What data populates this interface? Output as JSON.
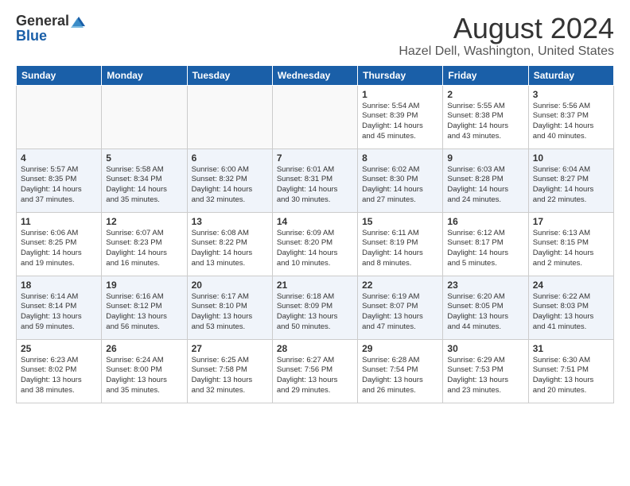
{
  "header": {
    "logo_general": "General",
    "logo_blue": "Blue",
    "month_title": "August 2024",
    "location": "Hazel Dell, Washington, United States"
  },
  "weekdays": [
    "Sunday",
    "Monday",
    "Tuesday",
    "Wednesday",
    "Thursday",
    "Friday",
    "Saturday"
  ],
  "weeks": [
    [
      {
        "day": "",
        "info": ""
      },
      {
        "day": "",
        "info": ""
      },
      {
        "day": "",
        "info": ""
      },
      {
        "day": "",
        "info": ""
      },
      {
        "day": "1",
        "info": "Sunrise: 5:54 AM\nSunset: 8:39 PM\nDaylight: 14 hours\nand 45 minutes."
      },
      {
        "day": "2",
        "info": "Sunrise: 5:55 AM\nSunset: 8:38 PM\nDaylight: 14 hours\nand 43 minutes."
      },
      {
        "day": "3",
        "info": "Sunrise: 5:56 AM\nSunset: 8:37 PM\nDaylight: 14 hours\nand 40 minutes."
      }
    ],
    [
      {
        "day": "4",
        "info": "Sunrise: 5:57 AM\nSunset: 8:35 PM\nDaylight: 14 hours\nand 37 minutes."
      },
      {
        "day": "5",
        "info": "Sunrise: 5:58 AM\nSunset: 8:34 PM\nDaylight: 14 hours\nand 35 minutes."
      },
      {
        "day": "6",
        "info": "Sunrise: 6:00 AM\nSunset: 8:32 PM\nDaylight: 14 hours\nand 32 minutes."
      },
      {
        "day": "7",
        "info": "Sunrise: 6:01 AM\nSunset: 8:31 PM\nDaylight: 14 hours\nand 30 minutes."
      },
      {
        "day": "8",
        "info": "Sunrise: 6:02 AM\nSunset: 8:30 PM\nDaylight: 14 hours\nand 27 minutes."
      },
      {
        "day": "9",
        "info": "Sunrise: 6:03 AM\nSunset: 8:28 PM\nDaylight: 14 hours\nand 24 minutes."
      },
      {
        "day": "10",
        "info": "Sunrise: 6:04 AM\nSunset: 8:27 PM\nDaylight: 14 hours\nand 22 minutes."
      }
    ],
    [
      {
        "day": "11",
        "info": "Sunrise: 6:06 AM\nSunset: 8:25 PM\nDaylight: 14 hours\nand 19 minutes."
      },
      {
        "day": "12",
        "info": "Sunrise: 6:07 AM\nSunset: 8:23 PM\nDaylight: 14 hours\nand 16 minutes."
      },
      {
        "day": "13",
        "info": "Sunrise: 6:08 AM\nSunset: 8:22 PM\nDaylight: 14 hours\nand 13 minutes."
      },
      {
        "day": "14",
        "info": "Sunrise: 6:09 AM\nSunset: 8:20 PM\nDaylight: 14 hours\nand 10 minutes."
      },
      {
        "day": "15",
        "info": "Sunrise: 6:11 AM\nSunset: 8:19 PM\nDaylight: 14 hours\nand 8 minutes."
      },
      {
        "day": "16",
        "info": "Sunrise: 6:12 AM\nSunset: 8:17 PM\nDaylight: 14 hours\nand 5 minutes."
      },
      {
        "day": "17",
        "info": "Sunrise: 6:13 AM\nSunset: 8:15 PM\nDaylight: 14 hours\nand 2 minutes."
      }
    ],
    [
      {
        "day": "18",
        "info": "Sunrise: 6:14 AM\nSunset: 8:14 PM\nDaylight: 13 hours\nand 59 minutes."
      },
      {
        "day": "19",
        "info": "Sunrise: 6:16 AM\nSunset: 8:12 PM\nDaylight: 13 hours\nand 56 minutes."
      },
      {
        "day": "20",
        "info": "Sunrise: 6:17 AM\nSunset: 8:10 PM\nDaylight: 13 hours\nand 53 minutes."
      },
      {
        "day": "21",
        "info": "Sunrise: 6:18 AM\nSunset: 8:09 PM\nDaylight: 13 hours\nand 50 minutes."
      },
      {
        "day": "22",
        "info": "Sunrise: 6:19 AM\nSunset: 8:07 PM\nDaylight: 13 hours\nand 47 minutes."
      },
      {
        "day": "23",
        "info": "Sunrise: 6:20 AM\nSunset: 8:05 PM\nDaylight: 13 hours\nand 44 minutes."
      },
      {
        "day": "24",
        "info": "Sunrise: 6:22 AM\nSunset: 8:03 PM\nDaylight: 13 hours\nand 41 minutes."
      }
    ],
    [
      {
        "day": "25",
        "info": "Sunrise: 6:23 AM\nSunset: 8:02 PM\nDaylight: 13 hours\nand 38 minutes."
      },
      {
        "day": "26",
        "info": "Sunrise: 6:24 AM\nSunset: 8:00 PM\nDaylight: 13 hours\nand 35 minutes."
      },
      {
        "day": "27",
        "info": "Sunrise: 6:25 AM\nSunset: 7:58 PM\nDaylight: 13 hours\nand 32 minutes."
      },
      {
        "day": "28",
        "info": "Sunrise: 6:27 AM\nSunset: 7:56 PM\nDaylight: 13 hours\nand 29 minutes."
      },
      {
        "day": "29",
        "info": "Sunrise: 6:28 AM\nSunset: 7:54 PM\nDaylight: 13 hours\nand 26 minutes."
      },
      {
        "day": "30",
        "info": "Sunrise: 6:29 AM\nSunset: 7:53 PM\nDaylight: 13 hours\nand 23 minutes."
      },
      {
        "day": "31",
        "info": "Sunrise: 6:30 AM\nSunset: 7:51 PM\nDaylight: 13 hours\nand 20 minutes."
      }
    ]
  ]
}
